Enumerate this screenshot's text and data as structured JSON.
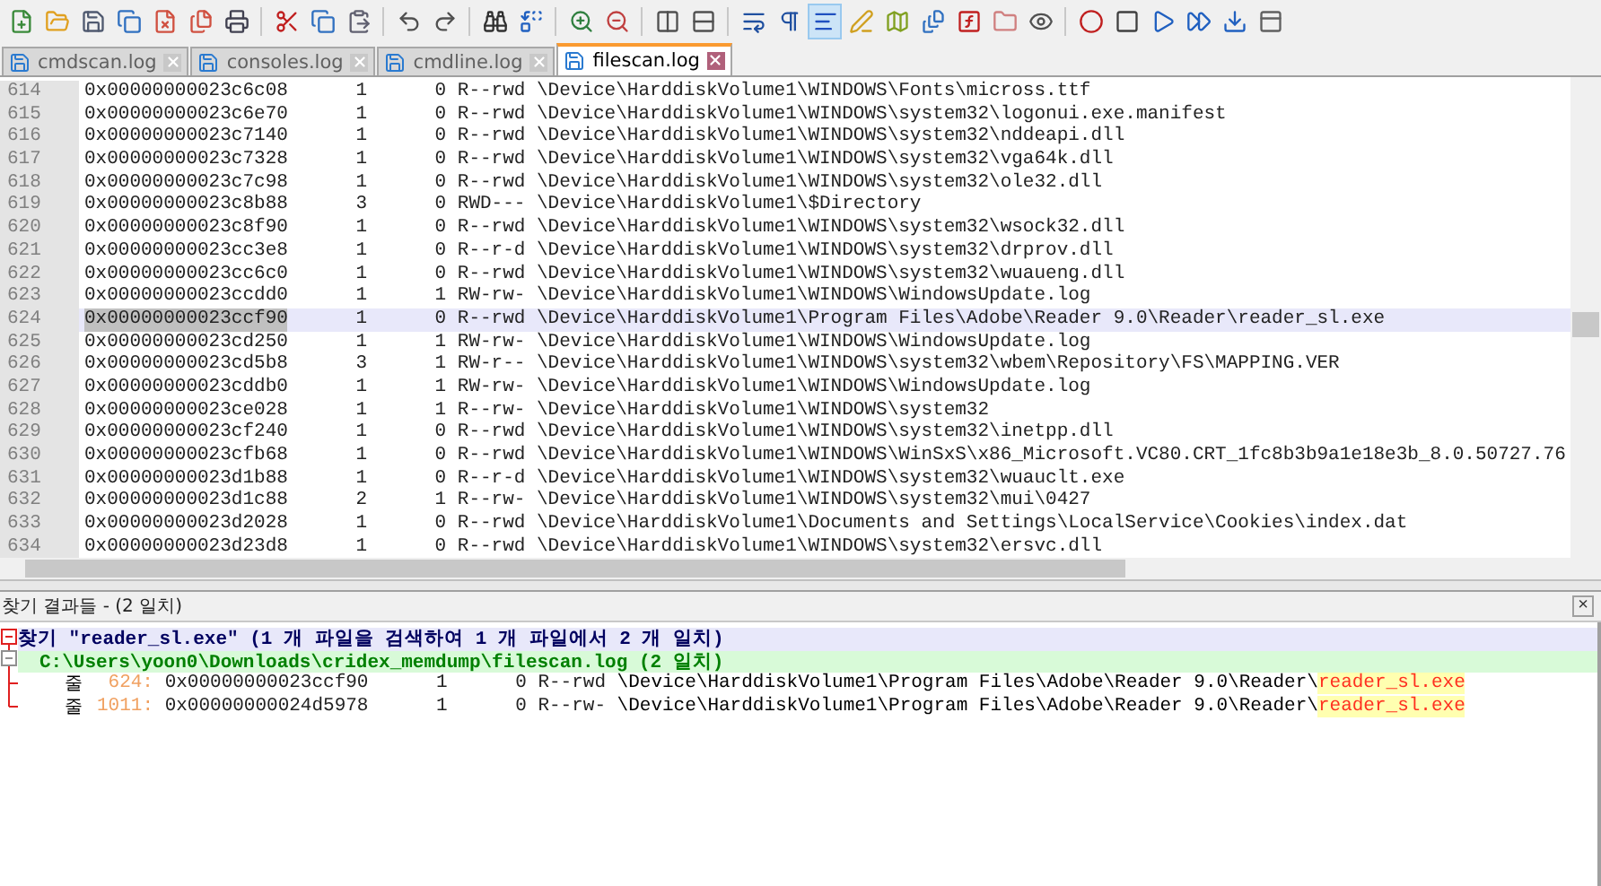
{
  "toolbar": [
    {
      "selected": false
    },
    {
      "selected": false
    },
    {
      "selected": false
    },
    {
      "selected": false
    },
    {
      "selected": false
    },
    {
      "selected": false
    },
    {
      "selected": false
    },
    {
      "selected": false
    },
    {
      "selected": false
    },
    {
      "selected": false
    },
    {
      "selected": false
    },
    {
      "selected": false
    },
    {
      "selected": false
    },
    {
      "selected": false
    },
    {
      "selected": false
    },
    {
      "selected": false
    },
    {
      "selected": false
    },
    {
      "selected": false
    },
    {
      "selected": false
    },
    {
      "selected": false
    },
    {
      "selected": true
    },
    {
      "selected": false
    },
    {
      "selected": false
    },
    {
      "selected": false
    },
    {
      "selected": false
    },
    {
      "selected": false
    },
    {
      "selected": false
    },
    {
      "selected": false
    },
    {
      "selected": false
    },
    {
      "selected": false
    },
    {
      "selected": false
    },
    {
      "selected": false
    },
    {
      "selected": false
    }
  ],
  "tabs": [
    {
      "label": "cmdscan.log",
      "selected": false
    },
    {
      "label": "consoles.log",
      "selected": false
    },
    {
      "label": "cmdline.log",
      "selected": false
    },
    {
      "label": "filescan.log",
      "selected": true
    }
  ],
  "editor": {
    "lines": [
      {
        "number": "614",
        "offset": "0x00000000023c6c08",
        "ptr": "1",
        "hnd": "0",
        "access": "R--rwd",
        "name": "\\Device\\HarddiskVolume1\\WINDOWS\\Fonts\\micross.ttf",
        "selected": false
      },
      {
        "number": "615",
        "offset": "0x00000000023c6e70",
        "ptr": "1",
        "hnd": "0",
        "access": "R--rwd",
        "name": "\\Device\\HarddiskVolume1\\WINDOWS\\system32\\logonui.exe.manifest",
        "selected": false
      },
      {
        "number": "616",
        "offset": "0x00000000023c7140",
        "ptr": "1",
        "hnd": "0",
        "access": "R--rwd",
        "name": "\\Device\\HarddiskVolume1\\WINDOWS\\system32\\nddeapi.dll",
        "selected": false
      },
      {
        "number": "617",
        "offset": "0x00000000023c7328",
        "ptr": "1",
        "hnd": "0",
        "access": "R--rwd",
        "name": "\\Device\\HarddiskVolume1\\WINDOWS\\system32\\vga64k.dll",
        "selected": false
      },
      {
        "number": "618",
        "offset": "0x00000000023c7c98",
        "ptr": "1",
        "hnd": "0",
        "access": "R--rwd",
        "name": "\\Device\\HarddiskVolume1\\WINDOWS\\system32\\ole32.dll",
        "selected": false
      },
      {
        "number": "619",
        "offset": "0x00000000023c8b88",
        "ptr": "3",
        "hnd": "0",
        "access": "RWD---",
        "name": "\\Device\\HarddiskVolume1\\$Directory",
        "selected": false
      },
      {
        "number": "620",
        "offset": "0x00000000023c8f90",
        "ptr": "1",
        "hnd": "0",
        "access": "R--rwd",
        "name": "\\Device\\HarddiskVolume1\\WINDOWS\\system32\\wsock32.dll",
        "selected": false
      },
      {
        "number": "621",
        "offset": "0x00000000023cc3e8",
        "ptr": "1",
        "hnd": "0",
        "access": "R--r-d",
        "name": "\\Device\\HarddiskVolume1\\WINDOWS\\system32\\drprov.dll",
        "selected": false
      },
      {
        "number": "622",
        "offset": "0x00000000023cc6c0",
        "ptr": "1",
        "hnd": "0",
        "access": "R--rwd",
        "name": "\\Device\\HarddiskVolume1\\WINDOWS\\system32\\wuaueng.dll",
        "selected": false
      },
      {
        "number": "623",
        "offset": "0x00000000023ccdd0",
        "ptr": "1",
        "hnd": "1",
        "access": "RW-rw-",
        "name": "\\Device\\HarddiskVolume1\\WINDOWS\\WindowsUpdate.log",
        "selected": false
      },
      {
        "number": "624",
        "offset": "0x00000000023ccf90",
        "ptr": "1",
        "hnd": "0",
        "access": "R--rwd",
        "name": "\\Device\\HarddiskVolume1\\Program Files\\Adobe\\Reader 9.0\\Reader\\reader_sl.exe",
        "selected": true
      },
      {
        "number": "625",
        "offset": "0x00000000023cd250",
        "ptr": "1",
        "hnd": "1",
        "access": "RW-rw-",
        "name": "\\Device\\HarddiskVolume1\\WINDOWS\\WindowsUpdate.log",
        "selected": false
      },
      {
        "number": "626",
        "offset": "0x00000000023cd5b8",
        "ptr": "3",
        "hnd": "1",
        "access": "RW-r--",
        "name": "\\Device\\HarddiskVolume1\\WINDOWS\\system32\\wbem\\Repository\\FS\\MAPPING.VER",
        "selected": false
      },
      {
        "number": "627",
        "offset": "0x00000000023cddb0",
        "ptr": "1",
        "hnd": "1",
        "access": "RW-rw-",
        "name": "\\Device\\HarddiskVolume1\\WINDOWS\\WindowsUpdate.log",
        "selected": false
      },
      {
        "number": "628",
        "offset": "0x00000000023ce028",
        "ptr": "1",
        "hnd": "1",
        "access": "R--rw-",
        "name": "\\Device\\HarddiskVolume1\\WINDOWS\\system32",
        "selected": false
      },
      {
        "number": "629",
        "offset": "0x00000000023cf240",
        "ptr": "1",
        "hnd": "0",
        "access": "R--rwd",
        "name": "\\Device\\HarddiskVolume1\\WINDOWS\\system32\\inetpp.dll",
        "selected": false
      },
      {
        "number": "630",
        "offset": "0x00000000023cfb68",
        "ptr": "1",
        "hnd": "0",
        "access": "R--rwd",
        "name": "\\Device\\HarddiskVolume1\\WINDOWS\\WinSxS\\x86_Microsoft.VC80.CRT_1fc8b3b9a1e18e3b_8.0.50727.76",
        "selected": false
      },
      {
        "number": "631",
        "offset": "0x00000000023d1b88",
        "ptr": "1",
        "hnd": "0",
        "access": "R--r-d",
        "name": "\\Device\\HarddiskVolume1\\WINDOWS\\system32\\wuauclt.exe",
        "selected": false
      },
      {
        "number": "632",
        "offset": "0x00000000023d1c88",
        "ptr": "2",
        "hnd": "1",
        "access": "R--rw-",
        "name": "\\Device\\HarddiskVolume1\\WINDOWS\\system32\\mui\\0427",
        "selected": false
      },
      {
        "number": "633",
        "offset": "0x00000000023d2028",
        "ptr": "1",
        "hnd": "0",
        "access": "R--rwd",
        "name": "\\Device\\HarddiskVolume1\\Documents and Settings\\LocalService\\Cookies\\index.dat",
        "selected": false
      },
      {
        "number": "634",
        "offset": "0x00000000023d23d8",
        "ptr": "1",
        "hnd": "0",
        "access": "R--rwd",
        "name": "\\Device\\HarddiskVolume1\\WINDOWS\\system32\\ersvc.dll",
        "selected": false
      }
    ]
  },
  "results": {
    "title": "찾기 결과들 - (2 일치)",
    "close": "×",
    "search": "찾기 \"reader_sl.exe\" (1 개 파일을 검색하여 1 개 파일에서 2 개 일치)",
    "file": "C:\\Users\\yoon0\\Downloads\\cridex_memdump\\filescan.log (2 일치)",
    "hits": [
      {
        "label": "줄",
        "number": "624:",
        "offset": "0x00000000023ccf90",
        "ptr": "1",
        "hnd": "0",
        "access": "R--rwd",
        "path": "\\Device\\HarddiskVolume1\\Program Files\\Adobe\\Reader 9.0\\Reader\\",
        "match": "reader_sl.exe"
      },
      {
        "label": "줄",
        "number": "1011:",
        "offset": "0x00000000024d5978",
        "ptr": "1",
        "hnd": "0",
        "access": "R--rw-",
        "path": "\\Device\\HarddiskVolume1\\Program Files\\Adobe\\Reader 9.0\\Reader\\",
        "match": "reader_sl.exe"
      }
    ]
  }
}
